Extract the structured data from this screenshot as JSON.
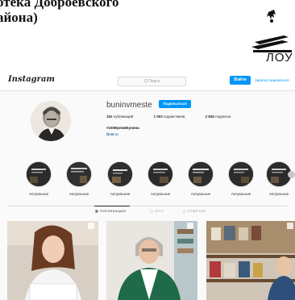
{
  "document": {
    "title_line1": "отека Доброевского",
    "title_line2": "айона)",
    "logo_text": "ЛОУ"
  },
  "instagram": {
    "logo": "Instagram",
    "search_placeholder": "Q Поиск",
    "login_label": "Войти",
    "register_label": "Зарегистрироваться"
  },
  "profile": {
    "username": "buninvmeste",
    "follow_label": "Подписаться",
    "stats": [
      {
        "value": "152",
        "label": "публикаций"
      },
      {
        "value": "1 003",
        "label": "подписчиков"
      },
      {
        "value": "2 845",
        "label": "подписок"
      }
    ],
    "hashtag": "#150ВремяБунина",
    "website": "lib46.ru"
  },
  "highlights": [
    {
      "label": "Актуальное"
    },
    {
      "label": "Актуальное"
    },
    {
      "label": "Актуальное"
    },
    {
      "label": "Актуальное"
    },
    {
      "label": "Актуальное"
    },
    {
      "label": "Актуальное"
    },
    {
      "label": "Актуальное"
    }
  ],
  "tabs": [
    {
      "label": "▦ ПУБЛИКАЦИИ"
    },
    {
      "label": "▢ IGTV"
    },
    {
      "label": "◻ ОТМЕТКИ"
    }
  ],
  "colors": {
    "accent": "#0095f6",
    "text": "#262626",
    "muted": "#8e8e8e"
  }
}
